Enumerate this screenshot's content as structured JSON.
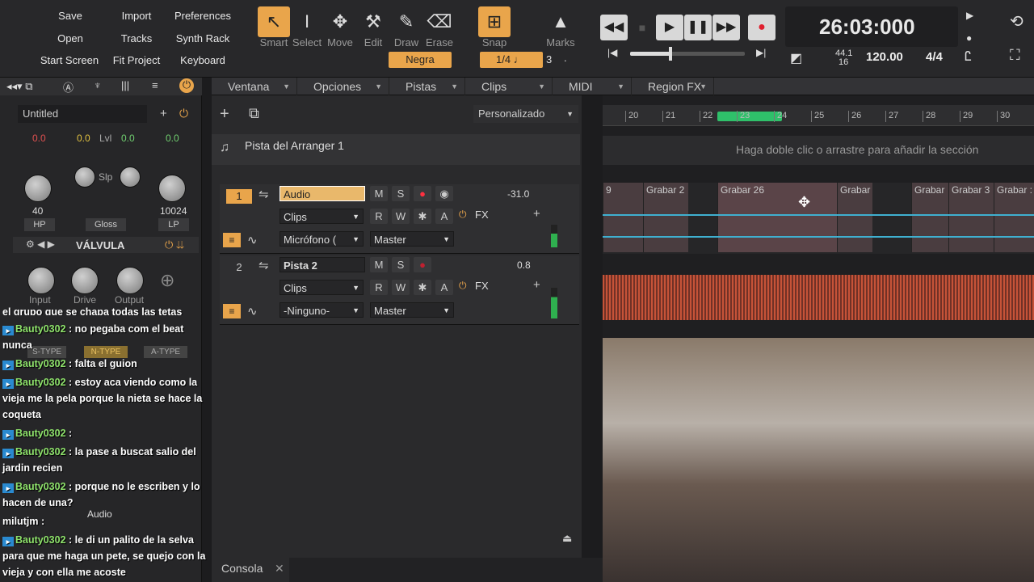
{
  "menu_buttons": [
    {
      "label": "Save"
    },
    {
      "label": "Import"
    },
    {
      "label": "Preferences"
    },
    {
      "label": "Open"
    },
    {
      "label": "Tracks"
    },
    {
      "label": "Synth Rack"
    },
    {
      "label": "Start Screen"
    },
    {
      "label": "Fit Project"
    },
    {
      "label": "Keyboard"
    }
  ],
  "tools": [
    {
      "label": "Smart",
      "glyph": "↖"
    },
    {
      "label": "Select",
      "glyph": "I"
    },
    {
      "label": "Move",
      "glyph": "✥"
    },
    {
      "label": "Edit",
      "glyph": "⚒"
    },
    {
      "label": "Draw",
      "glyph": "✎"
    },
    {
      "label": "Erase",
      "glyph": "⌫"
    }
  ],
  "snap": {
    "label": "Snap",
    "value": "1/4",
    "note": "♩",
    "count": "3",
    "dot": "."
  },
  "marks_label": "Marks",
  "note_value": "Negra",
  "transport": {
    "time": "26:03:000",
    "sample_rate_top": "44.1",
    "sample_rate_bottom": "16",
    "tempo": "120.00",
    "meter": "4/4"
  },
  "view_menus": [
    {
      "label": "Ventana"
    },
    {
      "label": "Opciones"
    },
    {
      "label": "Pistas"
    },
    {
      "label": "Clips"
    },
    {
      "label": "MIDI"
    },
    {
      "label": "Region FX"
    }
  ],
  "track_view": {
    "preset": "Personalizado",
    "arranger_track": "Pista del Arranger 1"
  },
  "ruler": [
    "20",
    "21",
    "22",
    "23",
    "24",
    "25",
    "26",
    "27",
    "28",
    "29",
    "30"
  ],
  "arranger_hint": "Haga doble clic o arrastre para añadir la sección",
  "tracks": [
    {
      "number": "1",
      "name": "Audio",
      "mode": "Clips",
      "input": "Micrófono (",
      "output": "Master",
      "volume": "-31.0",
      "fx": "FX"
    },
    {
      "number": "2",
      "name": "Pista 2",
      "mode": "Clips",
      "input": "-Ninguno-",
      "output": "Master",
      "volume": "0.8",
      "fx": "FX"
    }
  ],
  "track_buttons": {
    "mute": "M",
    "solo": "S",
    "read": "R",
    "write": "W",
    "lane": "A"
  },
  "clips": [
    {
      "name": "9"
    },
    {
      "name": "Grabar 2"
    },
    {
      "name": "Grabar 26"
    },
    {
      "name": "Grabar"
    },
    {
      "name": "Grabar"
    },
    {
      "name": "Grabar 3"
    },
    {
      "name": "Grabar :"
    }
  ],
  "console_tab": "Consola",
  "strip": {
    "name": "Untitled",
    "left_val": "0.0",
    "mid_val": "0.0",
    "lvl_label": "Lvl",
    "lvl_val": "0.0",
    "right_val": "0.0",
    "hp_freq": "40",
    "lp_freq": "10024",
    "hp": "HP",
    "gloss": "Gloss",
    "lp": "LP",
    "slp": "Slp",
    "fx_name": "VÁLVULA",
    "knobs": [
      "Input",
      "Drive",
      "Output"
    ]
  },
  "overlay_labels": [
    "S-TYPE",
    "N-TYPE",
    "A-TYPE",
    "Audio"
  ],
  "chat": [
    {
      "user": "",
      "text": "el grupo que se chapa todas las tetas"
    },
    {
      "user": "Bauty0302",
      "text": ": no pegaba com el beat nunca"
    },
    {
      "user": "Bauty0302",
      "text": ": falta el guion"
    },
    {
      "user": "Bauty0302",
      "text": ": estoy aca viendo como la vieja me la pela porque la nieta se hace la coqueta"
    },
    {
      "user": "Bauty0302",
      "text": ":"
    },
    {
      "user": "Bauty0302",
      "text": ": la pase a buscat salio del jardin recien"
    },
    {
      "user": "Bauty0302",
      "text": ": porque no le escriben y lo hacen de una?"
    },
    {
      "user": "milutjm",
      "text": ":"
    },
    {
      "user": "Bauty0302",
      "text": ": le di un palito de la selva para que me haga un pete, se quejo con la vieja y con ella me acoste"
    }
  ]
}
